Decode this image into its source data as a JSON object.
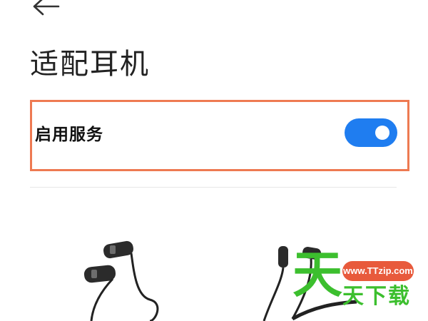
{
  "header": {
    "back_icon": "arrow-left-icon",
    "title": "适配耳机"
  },
  "service": {
    "label": "启用服务",
    "enabled": true,
    "toggle_color": "#1f7df0",
    "highlight_color": "#ee7a52"
  },
  "illustration": {
    "description_icon": "earphones-icon"
  },
  "watermark": {
    "char": "天",
    "url": "www.TTzip.com",
    "text": "天下载",
    "color": "#3cbf2e",
    "pill_color": "#e85a3c"
  }
}
